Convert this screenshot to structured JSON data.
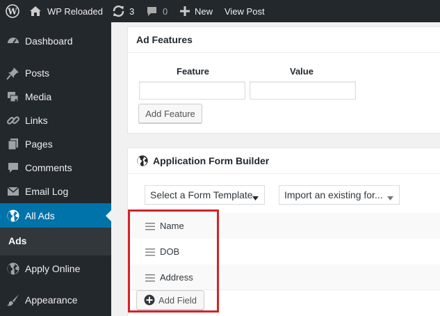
{
  "admin_bar": {
    "logo_icon": "wordpress-logo-icon",
    "site_name": "WP Reloaded",
    "updates_count": "3",
    "comments_count": "0",
    "new_label": "New",
    "view_post_label": "View Post"
  },
  "sidebar": {
    "items": [
      {
        "label": "Dashboard",
        "icon": "dashboard-icon"
      },
      {
        "label": "Posts",
        "icon": "pushpin-icon"
      },
      {
        "label": "Media",
        "icon": "media-icon"
      },
      {
        "label": "Links",
        "icon": "link-icon"
      },
      {
        "label": "Pages",
        "icon": "pages-icon"
      },
      {
        "label": "Comments",
        "icon": "comment-icon"
      },
      {
        "label": "Email Log",
        "icon": "email-icon"
      },
      {
        "label": "All Ads",
        "icon": "globe-icon",
        "active": true
      },
      {
        "label": "Apply Online",
        "icon": "globe-icon"
      },
      {
        "label": "Appearance",
        "icon": "brush-icon"
      }
    ],
    "submenu_label": "Ads"
  },
  "ad_features": {
    "title": "Ad Features",
    "feature_header": "Feature",
    "value_header": "Value",
    "feature_value": "",
    "value_value": "",
    "add_button": "Add Feature"
  },
  "form_builder": {
    "title": "Application Form Builder",
    "title_icon": "globe-icon",
    "template_select": "Select a Form Template",
    "import_select": "Import an existing for...",
    "fields": [
      "Name",
      "DOB",
      "Address"
    ],
    "add_field_button": "Add Field"
  },
  "colors": {
    "admin_bar_bg": "#23282d",
    "active_menu": "#0073aa",
    "highlight_border": "#d0232a"
  }
}
